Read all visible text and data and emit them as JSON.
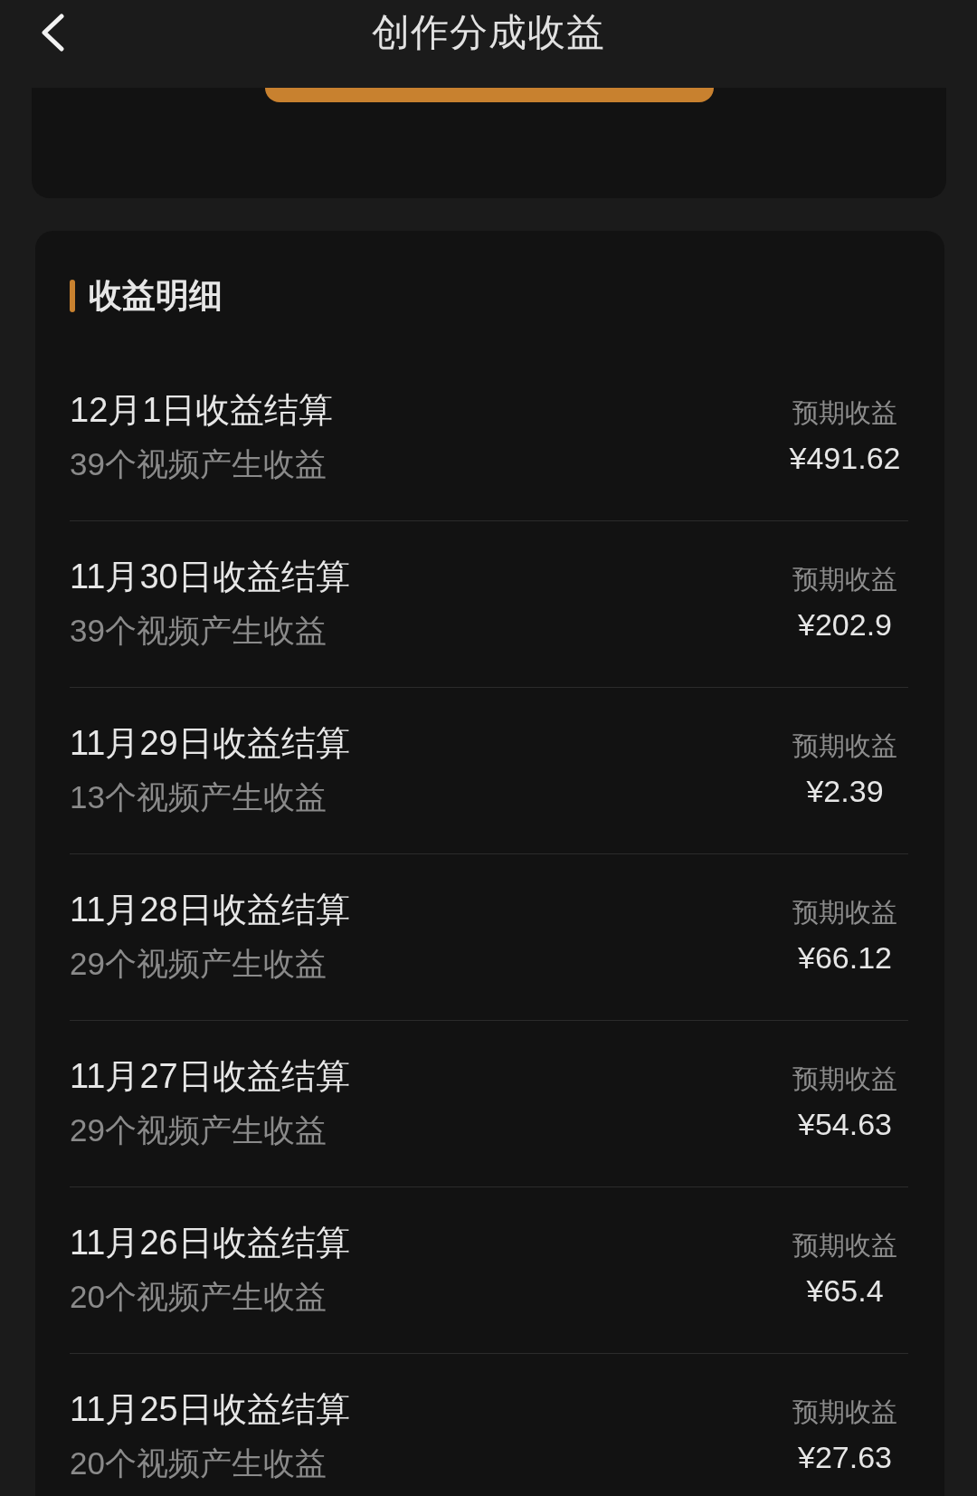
{
  "header": {
    "title": "创作分成收益"
  },
  "earnings_detail": {
    "title": "收益明细",
    "rows": [
      {
        "title": "12月1日收益结算",
        "subtitle": "39个视频产生收益",
        "label": "预期收益",
        "amount": "¥491.62"
      },
      {
        "title": "11月30日收益结算",
        "subtitle": "39个视频产生收益",
        "label": "预期收益",
        "amount": "¥202.9"
      },
      {
        "title": "11月29日收益结算",
        "subtitle": "13个视频产生收益",
        "label": "预期收益",
        "amount": "¥2.39"
      },
      {
        "title": "11月28日收益结算",
        "subtitle": "29个视频产生收益",
        "label": "预期收益",
        "amount": "¥66.12"
      },
      {
        "title": "11月27日收益结算",
        "subtitle": "29个视频产生收益",
        "label": "预期收益",
        "amount": "¥54.63"
      },
      {
        "title": "11月26日收益结算",
        "subtitle": "20个视频产生收益",
        "label": "预期收益",
        "amount": "¥65.4"
      },
      {
        "title": "11月25日收益结算",
        "subtitle": "20个视频产生收益",
        "label": "预期收益",
        "amount": "¥27.63"
      }
    ]
  }
}
